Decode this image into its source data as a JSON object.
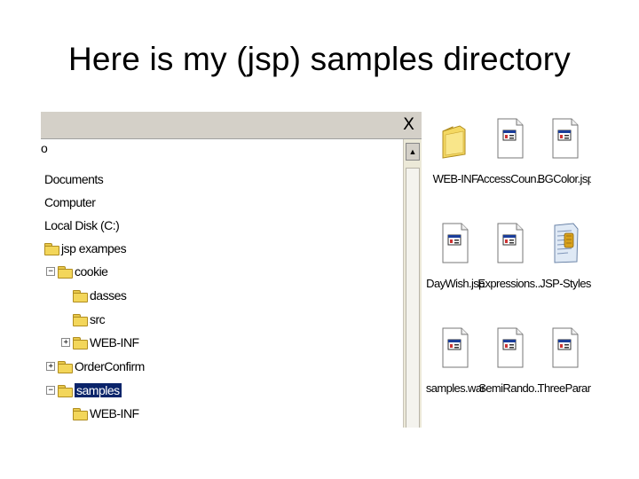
{
  "slide": {
    "title": "Here is my (jsp) samples directory"
  },
  "window": {
    "close_glyph": "X",
    "top_fragment": "o"
  },
  "tree": {
    "items": [
      {
        "label": "Documents",
        "indent": 0,
        "folder": false,
        "expander": ""
      },
      {
        "label": "Computer",
        "indent": 0,
        "folder": false,
        "expander": ""
      },
      {
        "label": "Local Disk (C:)",
        "indent": 0,
        "folder": false,
        "expander": ""
      },
      {
        "label": "jsp exampes",
        "indent": 0,
        "folder": true,
        "expander": ""
      },
      {
        "label": "cookie",
        "indent": 1,
        "folder": true,
        "expander": "−"
      },
      {
        "label": "dasses",
        "indent": 2,
        "folder": true,
        "expander": ""
      },
      {
        "label": "src",
        "indent": 2,
        "folder": true,
        "expander": ""
      },
      {
        "label": "WEB-INF",
        "indent": 2,
        "folder": true,
        "expander": "+"
      },
      {
        "label": "OrderConfirm",
        "indent": 1,
        "folder": true,
        "expander": "+"
      },
      {
        "label": "samples",
        "indent": 1,
        "folder": true,
        "expander": "−",
        "selected": true
      },
      {
        "label": "WEB-INF",
        "indent": 2,
        "folder": true,
        "expander": ""
      }
    ]
  },
  "files": [
    {
      "label": "WEB-INF",
      "type": "folder"
    },
    {
      "label": "AccessCoun...",
      "type": "jsp"
    },
    {
      "label": "BGColor.jsp",
      "type": "jsp"
    },
    {
      "label": "DayWish.jsp",
      "type": "jsp"
    },
    {
      "label": "Expressions...",
      "type": "jsp"
    },
    {
      "label": "JSP-Styles",
      "type": "css"
    },
    {
      "label": "samples.war",
      "type": "jsp"
    },
    {
      "label": "SemiRando...",
      "type": "jsp"
    },
    {
      "label": "ThreeParan",
      "type": "jsp"
    }
  ]
}
